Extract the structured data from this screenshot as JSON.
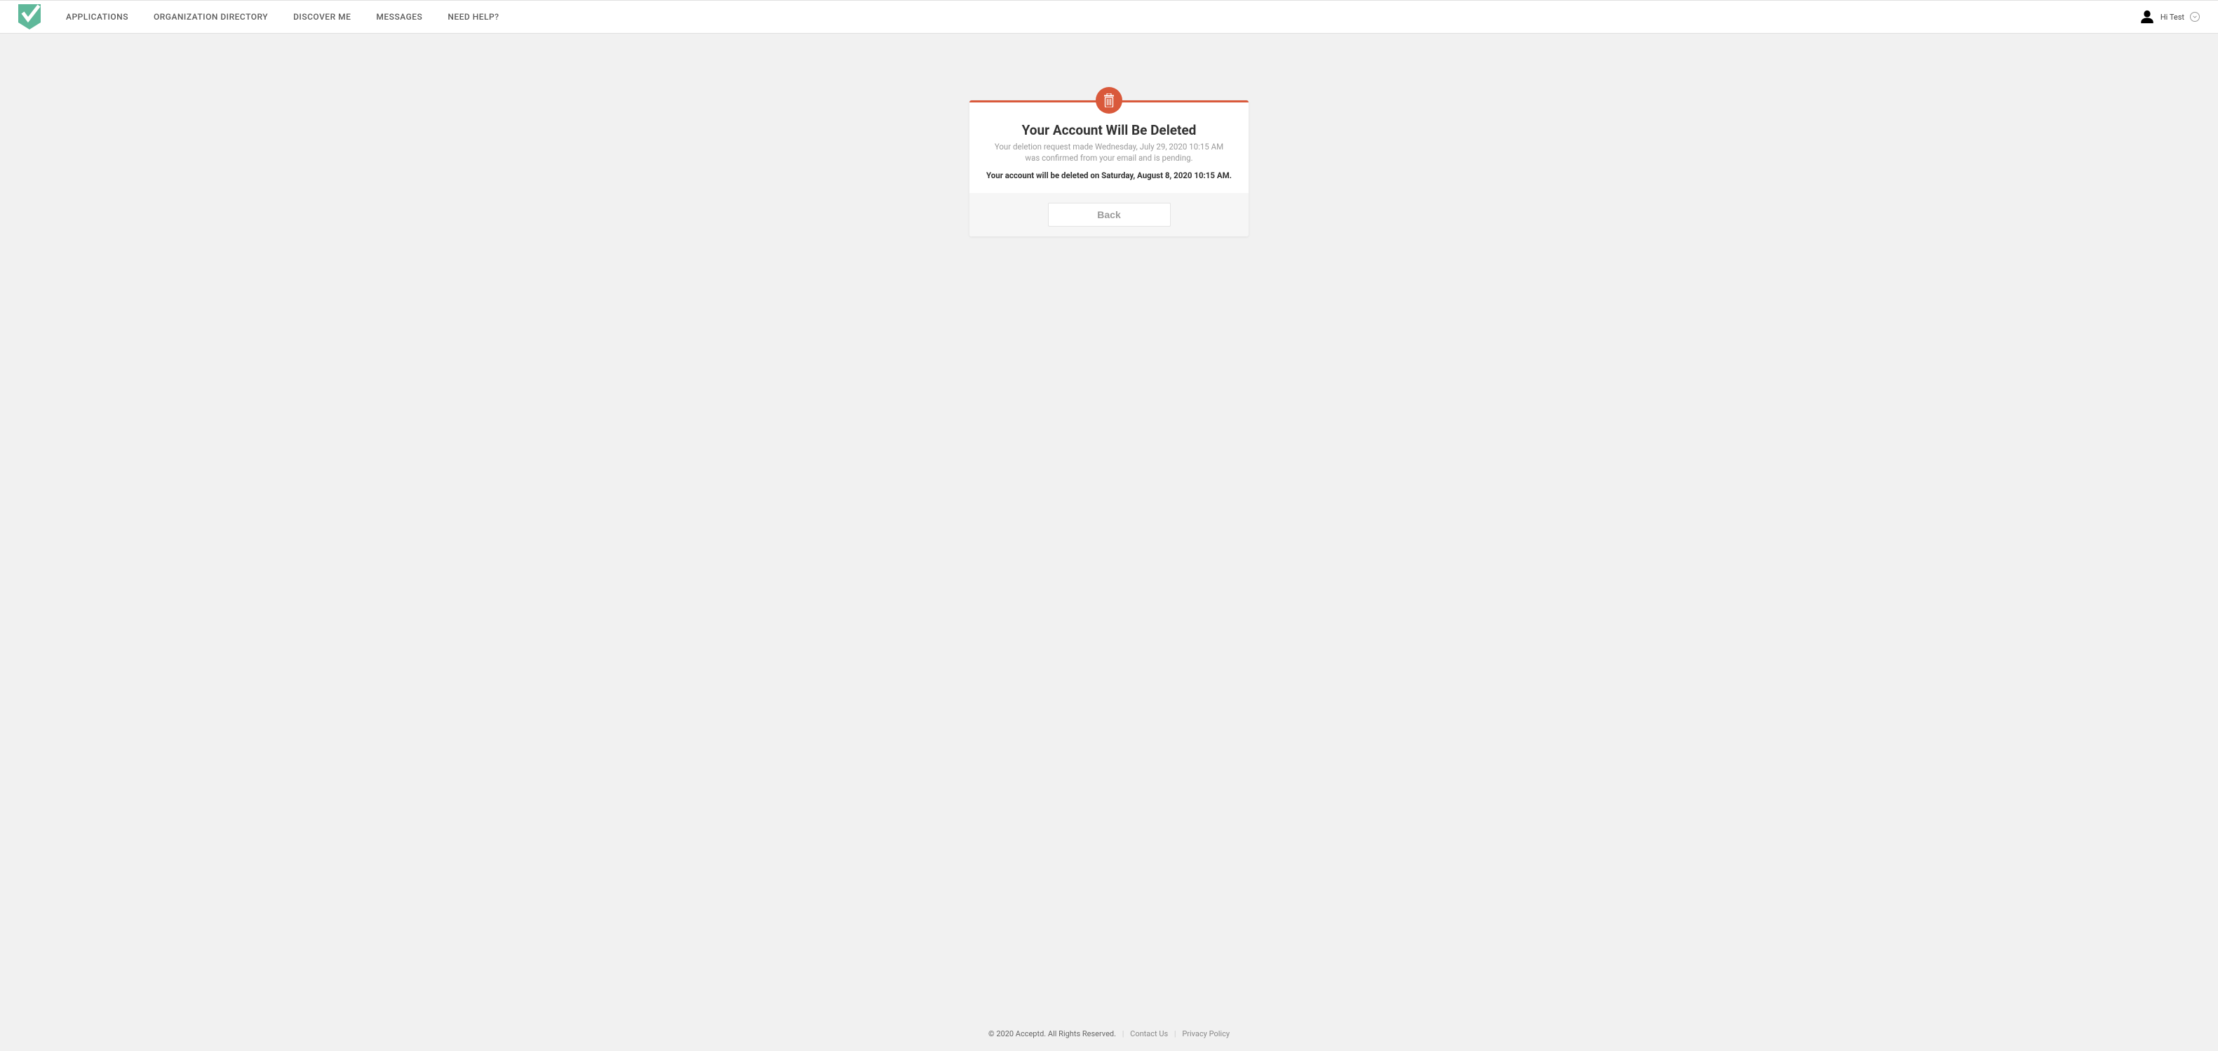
{
  "nav": {
    "items": [
      {
        "label": "APPLICATIONS"
      },
      {
        "label": "ORGANIZATION DIRECTORY"
      },
      {
        "label": "DISCOVER ME"
      },
      {
        "label": "MESSAGES"
      },
      {
        "label": "NEED HELP?"
      }
    ]
  },
  "user": {
    "greeting": "Hi Test"
  },
  "card": {
    "title": "Your Account Will Be Deleted",
    "description": "Your deletion request made Wednesday, July 29, 2020 10:15 AM was confirmed from your email and is pending.",
    "scheduled_text": "Your account will be deleted on Saturday, August 8, 2020 10:15 AM.",
    "back_label": "Back"
  },
  "footer": {
    "copyright": "© 2020 Acceptd. All Rights Reserved.",
    "contact": "Contact Us",
    "privacy": "Privacy Policy"
  },
  "colors": {
    "accent_green": "#5fb89a",
    "accent_red": "#d9593b"
  }
}
